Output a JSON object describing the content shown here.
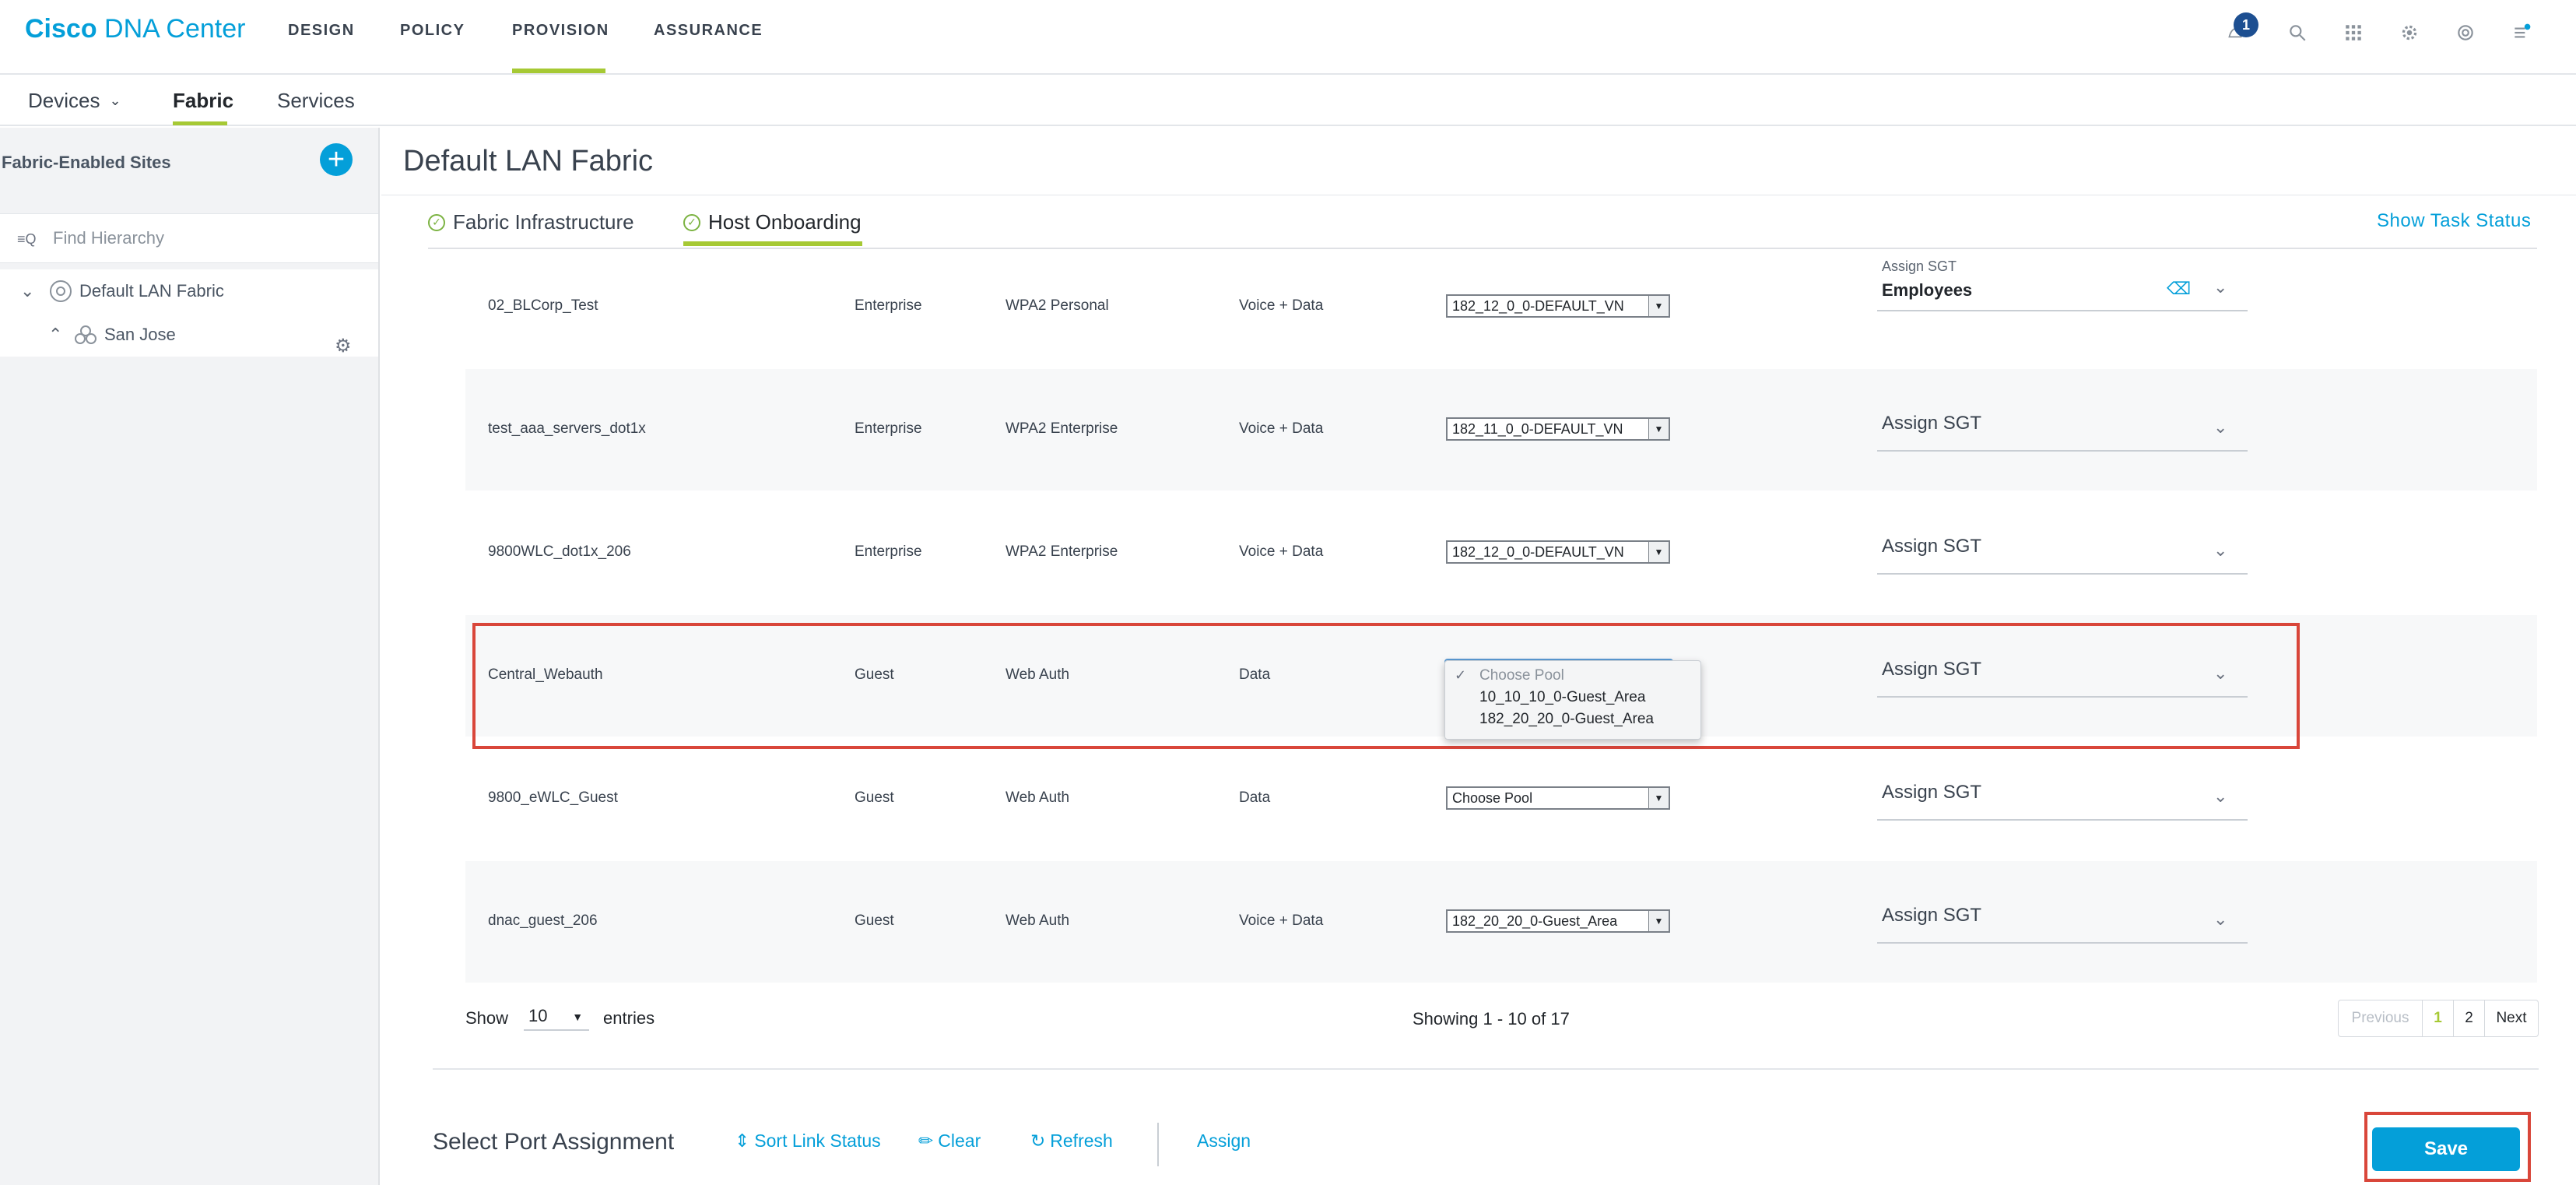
{
  "brand": {
    "strong": "Cisco",
    "rest": " DNA Center"
  },
  "topnav": {
    "items": [
      "DESIGN",
      "POLICY",
      "PROVISION",
      "ASSURANCE"
    ],
    "notification_count": "1"
  },
  "subnav": {
    "devices": "Devices",
    "fabric": "Fabric",
    "services": "Services"
  },
  "sidebar": {
    "title": "Fabric-Enabled Sites",
    "search_placeholder": "Find Hierarchy",
    "tree": [
      "Default LAN Fabric",
      "San Jose"
    ]
  },
  "main": {
    "title": "Default LAN Fabric",
    "tabs": [
      "Fabric Infrastructure",
      "Host Onboarding"
    ],
    "show_task_status": "Show Task Status"
  },
  "ssids": [
    {
      "name": "02_BLCorp_Test",
      "type": "Enterprise",
      "security": "WPA2 Personal",
      "traffic": "Voice + Data",
      "pool": "182_12_0_0-DEFAULT_VN",
      "sgt": "Employees"
    },
    {
      "name": "test_aaa_servers_dot1x",
      "type": "Enterprise",
      "security": "WPA2 Enterprise",
      "traffic": "Voice + Data",
      "pool": "182_11_0_0-DEFAULT_VN",
      "sgt": ""
    },
    {
      "name": "9800WLC_dot1x_206",
      "type": "Enterprise",
      "security": "WPA2 Enterprise",
      "traffic": "Voice + Data",
      "pool": "182_12_0_0-DEFAULT_VN",
      "sgt": ""
    },
    {
      "name": "Central_Webauth",
      "type": "Guest",
      "security": "Web Auth",
      "traffic": "Data",
      "pool": "",
      "sgt": ""
    },
    {
      "name": "9800_eWLC_Guest",
      "type": "Guest",
      "security": "Web Auth",
      "traffic": "Data",
      "pool": "Choose Pool",
      "sgt": ""
    },
    {
      "name": "dnac_guest_206",
      "type": "Guest",
      "security": "Web Auth",
      "traffic": "Voice + Data",
      "pool": "182_20_20_0-Guest_Area",
      "sgt": ""
    }
  ],
  "sgt_placeholder": "Assign SGT",
  "sgt_header": "Assign SGT",
  "pool_dropdown": {
    "options": [
      "Choose Pool",
      "10_10_10_0-Guest_Area",
      "182_20_20_0-Guest_Area"
    ]
  },
  "pager": {
    "show": "Show",
    "entries_value": "10",
    "entries": "entries",
    "showing": "Showing 1 - 10 of 17",
    "previous": "Previous",
    "pages": [
      "1",
      "2"
    ],
    "next": "Next"
  },
  "footer": {
    "title": "Select Port Assignment",
    "sort_link_status": "Sort Link Status",
    "clear": "Clear",
    "refresh": "Refresh",
    "assign": "Assign",
    "save": "Save"
  },
  "colors": {
    "accent": "#049fd9",
    "active_bar": "#a6c934",
    "highlight": "#d9463a"
  }
}
